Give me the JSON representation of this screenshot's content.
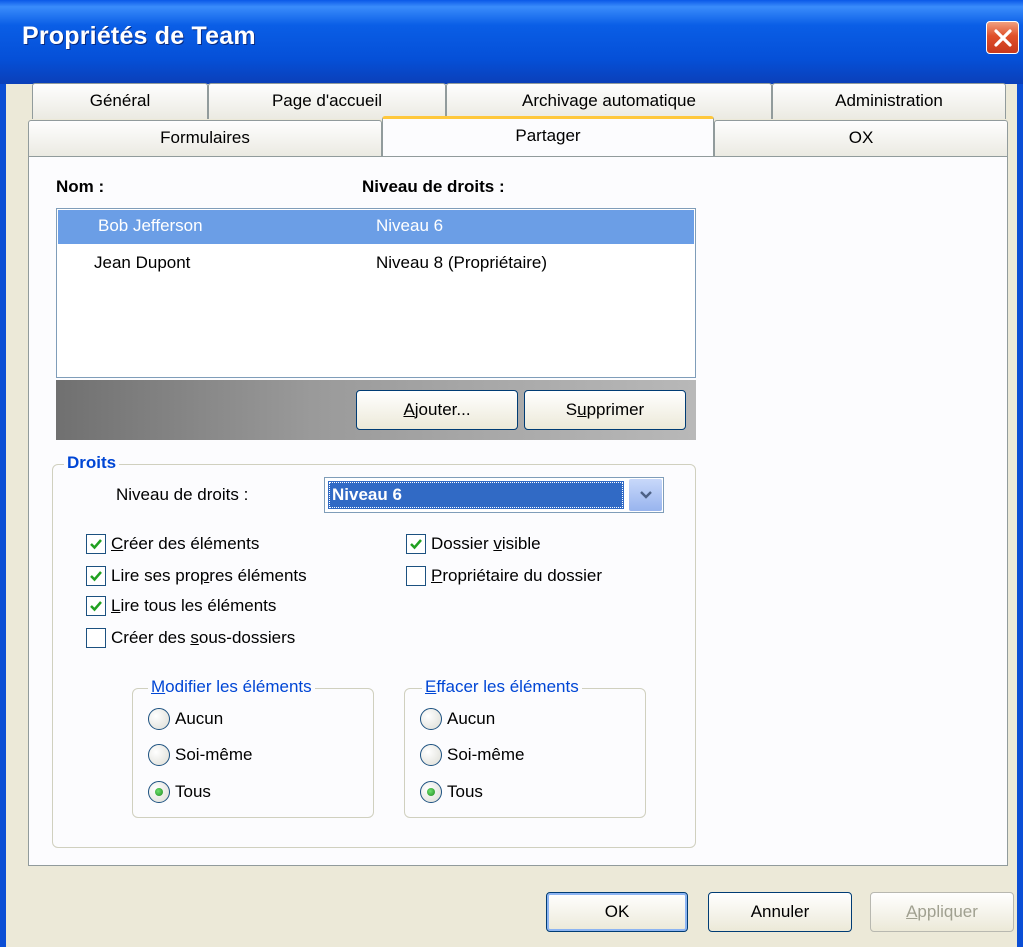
{
  "window": {
    "title": "Propriétés de Team"
  },
  "tabs": {
    "row1": [
      "Général",
      "Page d'accueil",
      "Archivage automatique",
      "Administration"
    ],
    "row2": [
      "Formulaires",
      "Partager",
      "OX"
    ],
    "active": "Partager"
  },
  "list": {
    "headers": {
      "name": "Nom :",
      "level": "Niveau de droits :"
    },
    "rows": [
      {
        "name": "Bob Jefferson",
        "level": "Niveau 6",
        "selected": true
      },
      {
        "name": "Jean Dupont",
        "level": "Niveau 8 (Propriétaire)",
        "selected": false
      }
    ]
  },
  "buttons": {
    "add": {
      "pre": "",
      "key": "A",
      "post": "jouter..."
    },
    "remove": {
      "pre": "S",
      "key": "u",
      "post": "pprimer"
    },
    "ok": "OK",
    "cancel": "Annuler",
    "apply": {
      "key": "A",
      "post": "ppliquer"
    }
  },
  "rights": {
    "group_title": "Droits",
    "level_label": "Niveau de droits :",
    "level_value": "Niveau 6",
    "checkboxes": [
      {
        "key": "C",
        "rest": "réer des éléments",
        "checked": true
      },
      {
        "pre": "Lire ses pro",
        "key": "p",
        "rest": "res éléments",
        "checked": true
      },
      {
        "key": "L",
        "rest": "ire tous les éléments",
        "checked": true
      },
      {
        "pre": "Créer des ",
        "key": "s",
        "rest": "ous-dossiers",
        "checked": false
      },
      {
        "pre": "Dossier ",
        "key": "v",
        "rest": "isible",
        "checked": true
      },
      {
        "key": "P",
        "rest": "ropriétaire du dossier",
        "checked": false
      }
    ],
    "modify": {
      "title_key": "M",
      "title_rest": "odifier les éléments",
      "options": [
        "Aucun",
        "Soi-même",
        "Tous"
      ],
      "selected": "Tous"
    },
    "delete": {
      "title_key": "E",
      "title_rest": "ffacer les éléments",
      "options": [
        "Aucun",
        "Soi-même",
        "Tous"
      ],
      "selected": "Tous"
    }
  },
  "colors": {
    "titlebar": "#0550d8",
    "selection": "#6b9ee6",
    "group_title": "#0046d5"
  }
}
